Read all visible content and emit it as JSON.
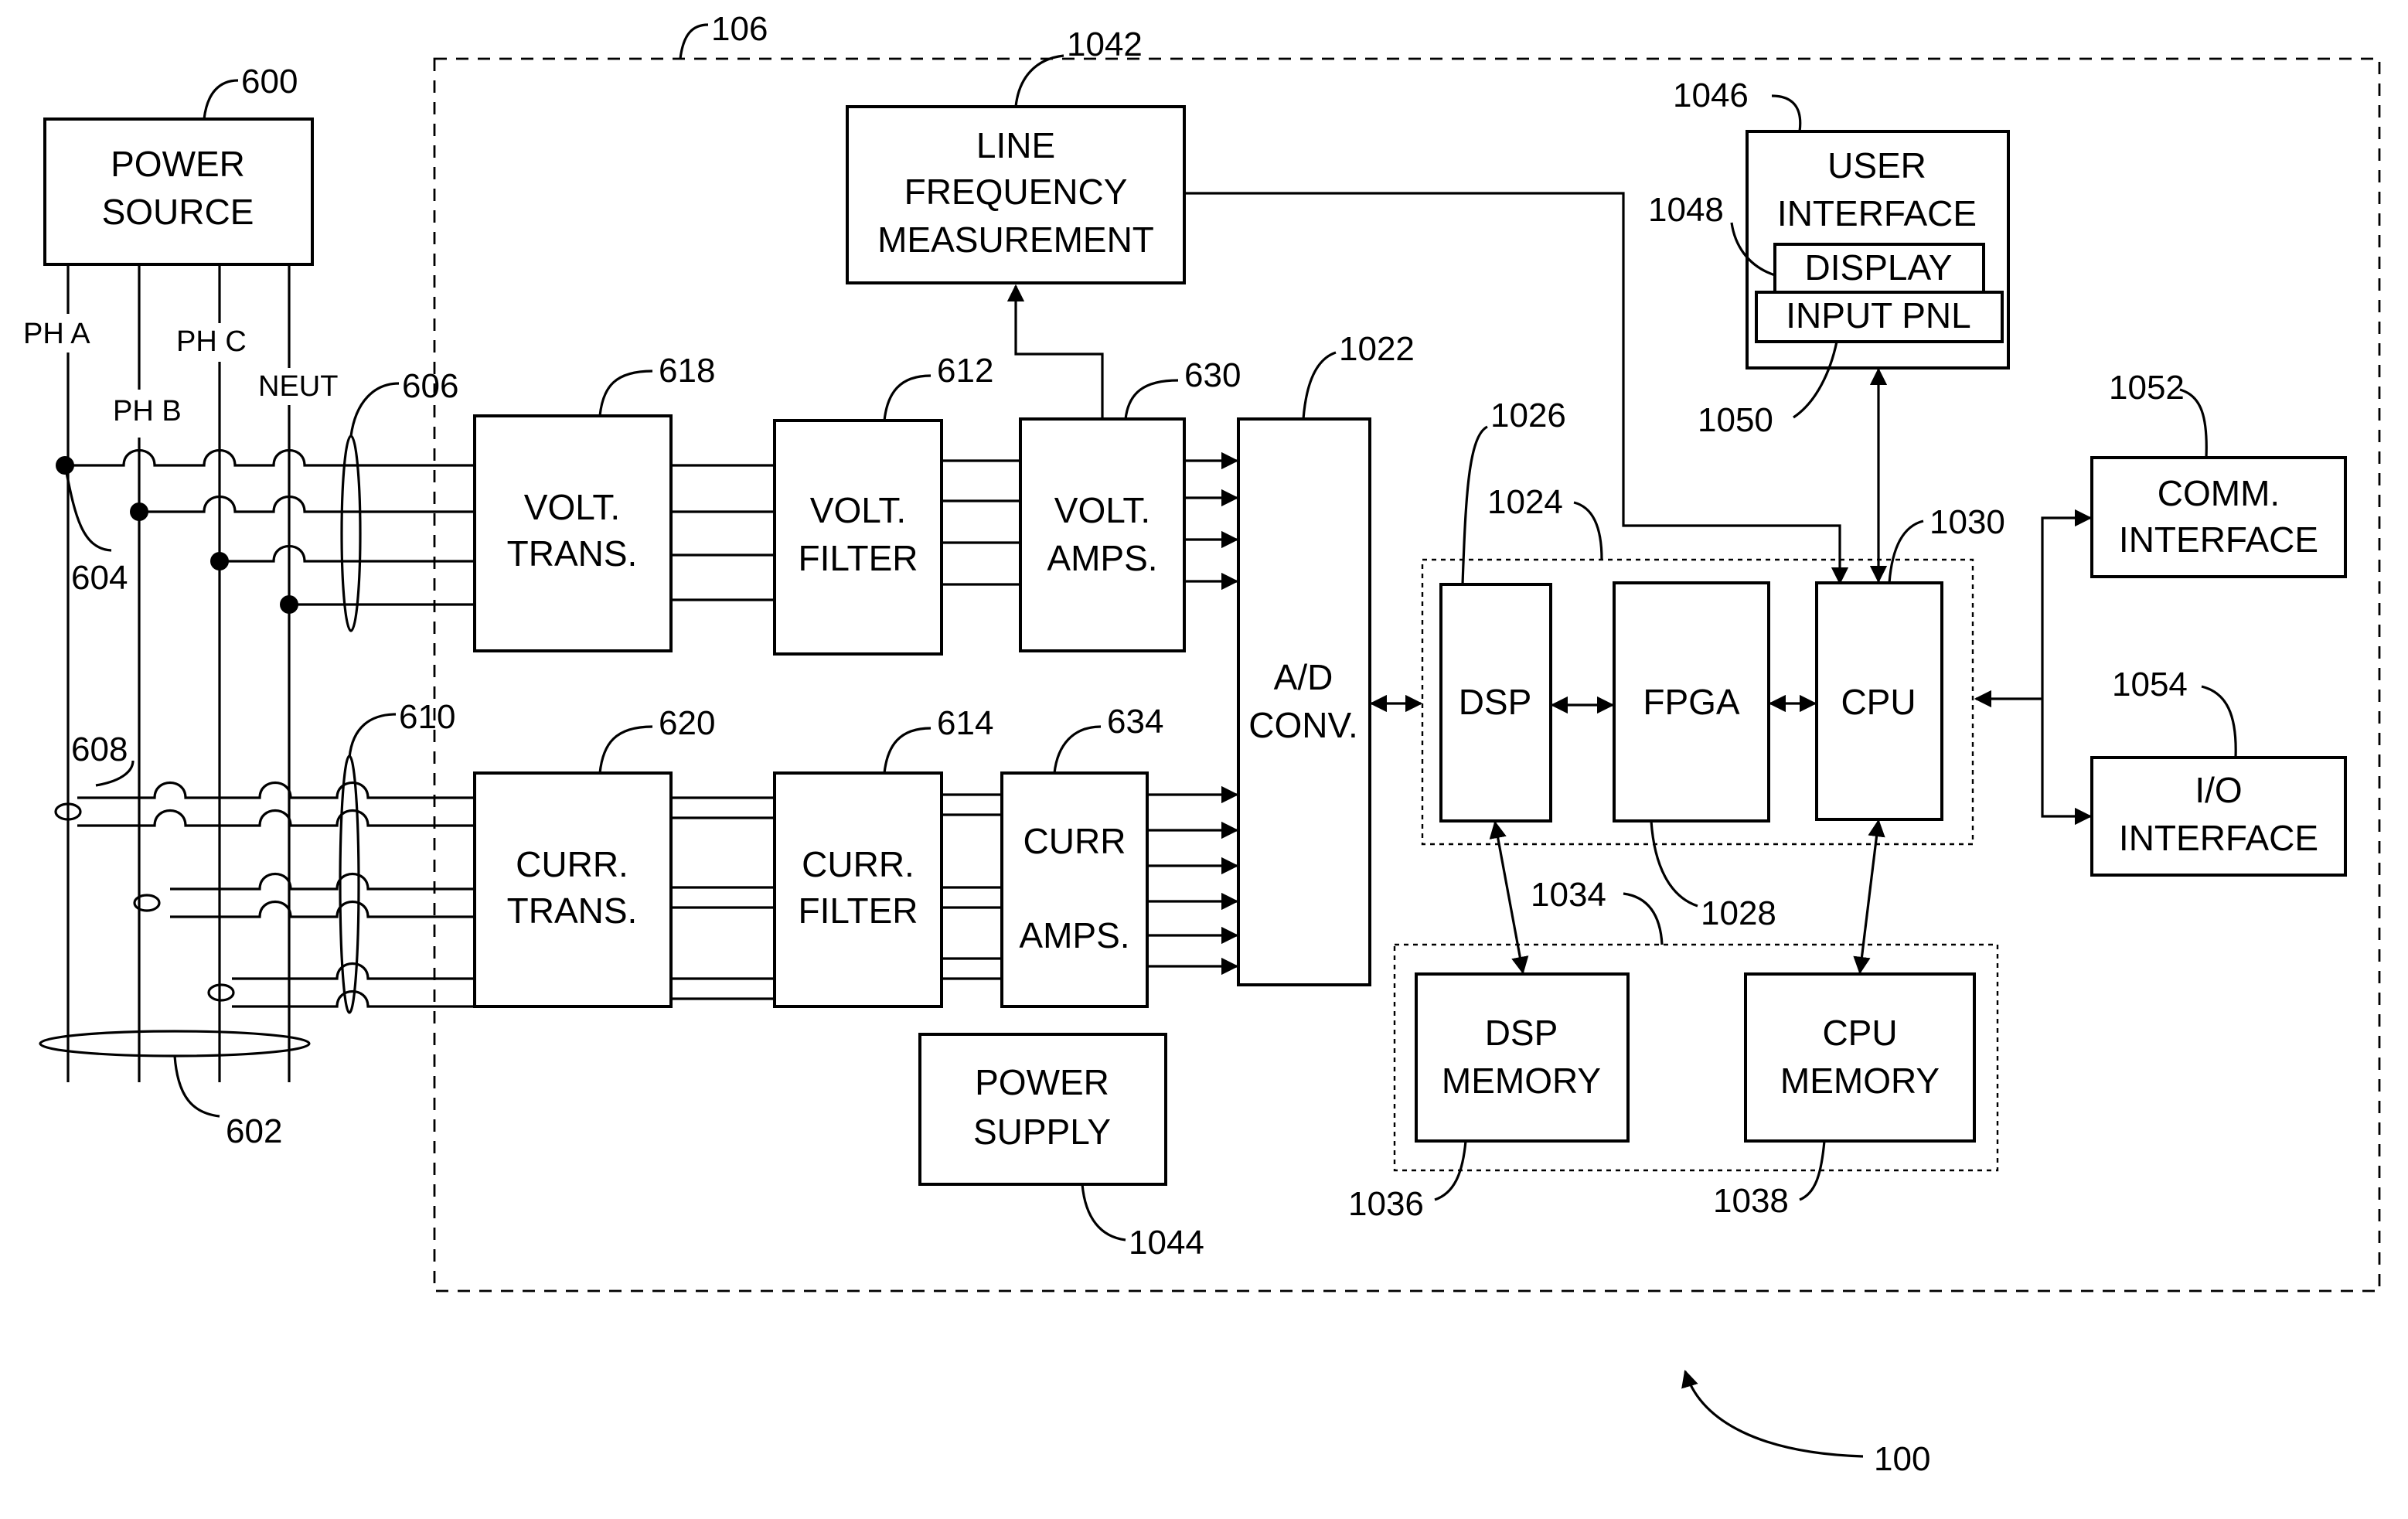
{
  "diagram": {
    "figure_ref": "100",
    "meter_ref": "106",
    "power_source": {
      "ref": "600",
      "lines": [
        "POWER",
        "SOURCE"
      ]
    },
    "phase_labels": [
      "PH A",
      "PH B",
      "PH C",
      "NEUT"
    ],
    "refs": {
      "conductors": "602",
      "voltage_tap": "604",
      "voltage_bundle": "606",
      "current_sensor": "608",
      "current_bundle": "610"
    },
    "blocks": {
      "volt_trans": {
        "ref": "618",
        "lines": [
          "VOLT.",
          "TRANS."
        ]
      },
      "volt_filter": {
        "ref": "612",
        "lines": [
          "VOLT.",
          "FILTER"
        ]
      },
      "volt_amps": {
        "ref": "630",
        "lines": [
          "VOLT.",
          "AMPS."
        ]
      },
      "curr_trans": {
        "ref": "620",
        "lines": [
          "CURR.",
          "TRANS."
        ]
      },
      "curr_filter": {
        "ref": "614",
        "lines": [
          "CURR.",
          "FILTER"
        ]
      },
      "curr_amps": {
        "ref": "634",
        "lines": [
          "CURR",
          "AMPS."
        ]
      },
      "line_freq": {
        "ref": "1042",
        "lines": [
          "LINE",
          "FREQUENCY",
          "MEASUREMENT"
        ]
      },
      "ad_conv": {
        "ref": "1022",
        "lines": [
          "A/D",
          "CONV."
        ]
      },
      "processing_group": {
        "ref": "1024"
      },
      "dsp": {
        "ref": "1026",
        "label": "DSP"
      },
      "fpga": {
        "ref": "1028",
        "label": "FPGA"
      },
      "cpu": {
        "ref": "1030",
        "label": "CPU"
      },
      "memory_group": {
        "ref": "1034"
      },
      "dsp_memory": {
        "ref": "1036",
        "lines": [
          "DSP",
          "MEMORY"
        ]
      },
      "cpu_memory": {
        "ref": "1038",
        "lines": [
          "CPU",
          "MEMORY"
        ]
      },
      "power_supply": {
        "ref": "1044",
        "lines": [
          "POWER",
          "SUPPLY"
        ]
      },
      "user_interface": {
        "ref": "1046",
        "lines": [
          "USER",
          "INTERFACE"
        ]
      },
      "display": {
        "ref": "1048",
        "label": "DISPLAY"
      },
      "input_panel": {
        "ref": "1050",
        "label": "INPUT PNL"
      },
      "comm_interface": {
        "ref": "1052",
        "lines": [
          "COMM.",
          "INTERFACE"
        ]
      },
      "io_interface": {
        "ref": "1054",
        "lines": [
          "I/O",
          "INTERFACE"
        ]
      }
    }
  }
}
